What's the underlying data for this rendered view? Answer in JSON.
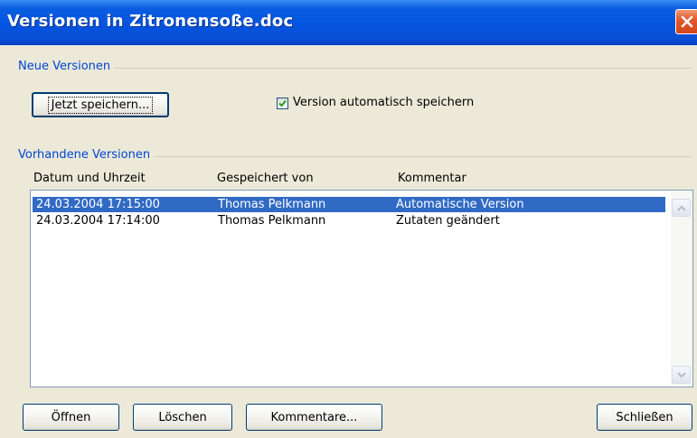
{
  "window": {
    "title": "Versionen in Zitronensoße.doc"
  },
  "new_versions": {
    "group_label": "Neue Versionen",
    "save_now_label": "Jetzt speichern...",
    "auto_save_label": "Version automatisch speichern",
    "auto_save_checked": true
  },
  "existing_versions": {
    "group_label": "Vorhandene Versionen",
    "columns": [
      "Datum und Uhrzeit",
      "Gespeichert von",
      "Kommentar"
    ],
    "rows": [
      {
        "date": "24.03.2004 17:15:00",
        "by": "Thomas Pelkmann",
        "comment": "Automatische Version",
        "selected": true
      },
      {
        "date": "24.03.2004 17:14:00",
        "by": "Thomas Pelkmann",
        "comment": "Zutaten geändert",
        "selected": false
      }
    ]
  },
  "buttons": {
    "open": "Öffnen",
    "delete": "Löschen",
    "comments": "Kommentare...",
    "close": "Schließen"
  },
  "colors": {
    "titlebar": "#0554e0",
    "group_label": "#0046d5",
    "selection": "#316ac5",
    "dialog_bg": "#ece9d8"
  }
}
